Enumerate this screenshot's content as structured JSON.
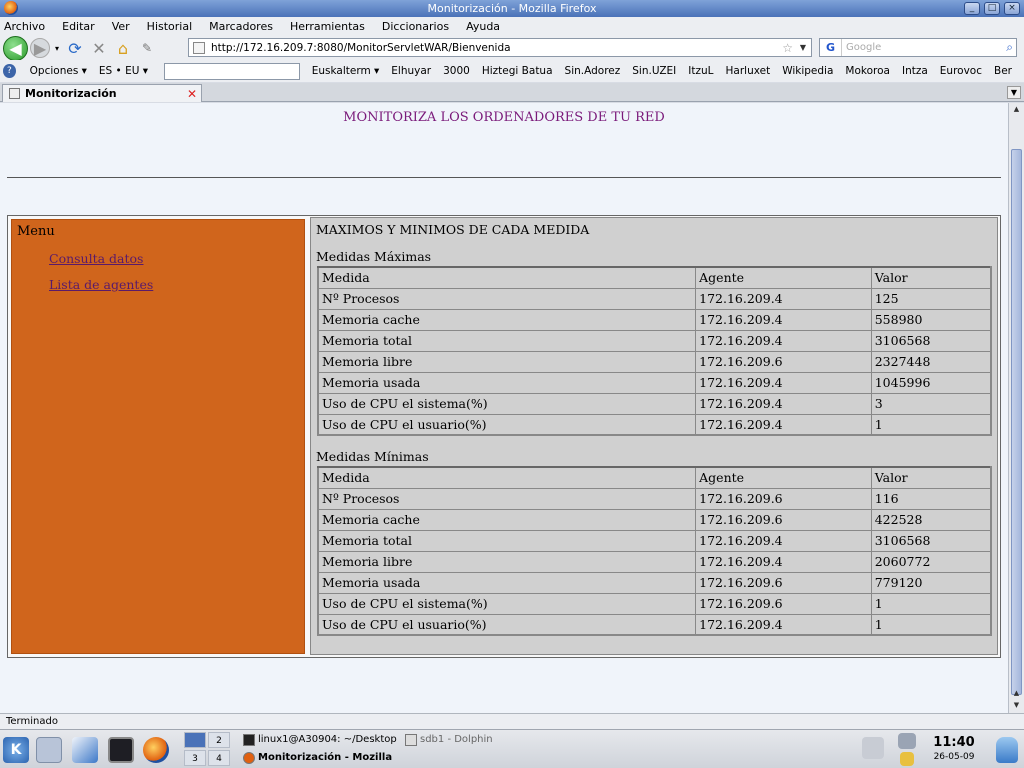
{
  "window": {
    "title": "Monitorización - Mozilla Firefox"
  },
  "menubar": {
    "items": [
      "Archivo",
      "Editar",
      "Ver",
      "Historial",
      "Marcadores",
      "Herramientas",
      "Diccionarios",
      "Ayuda"
    ]
  },
  "navbar": {
    "url": "http://172.16.209.7:8080/MonitorServletWAR/Bienvenida",
    "search_placeholder": "Google"
  },
  "bookmarks": {
    "items": [
      "Opciones ▾",
      "ES • EU ▾",
      "Euskalterm ▾",
      "Elhuyar",
      "3000",
      "Hiztegi Batua",
      "Sin.Adorez",
      "Sin.UZEI",
      "ItzuL",
      "Harluxet",
      "Wikipedia",
      "Mokoroa",
      "Intza",
      "Eurovoc",
      "Ber"
    ]
  },
  "tab": {
    "label": "Monitorización"
  },
  "page": {
    "header": "MONITORIZA LOS ORDENADORES DE TU RED",
    "menu": {
      "title": "Menu",
      "links": [
        "Consulta datos",
        "Lista de agentes"
      ]
    },
    "main_title": "MAXIMOS Y MINIMOS DE CADA MEDIDA",
    "max": {
      "title": "Medidas Máximas",
      "headers": [
        "Medida",
        "Agente",
        "Valor"
      ],
      "rows": [
        [
          "Nº Procesos",
          "172.16.209.4",
          "125"
        ],
        [
          "Memoria cache",
          "172.16.209.4",
          "558980"
        ],
        [
          "Memoria total",
          "172.16.209.4",
          "3106568"
        ],
        [
          "Memoria libre",
          "172.16.209.6",
          "2327448"
        ],
        [
          "Memoria usada",
          "172.16.209.4",
          "1045996"
        ],
        [
          "Uso de CPU el sistema(%)",
          "172.16.209.4",
          "3"
        ],
        [
          "Uso de CPU el usuario(%)",
          "172.16.209.4",
          "1"
        ]
      ]
    },
    "min": {
      "title": "Medidas Mínimas",
      "headers": [
        "Medida",
        "Agente",
        "Valor"
      ],
      "rows": [
        [
          "Nº Procesos",
          "172.16.209.6",
          "116"
        ],
        [
          "Memoria cache",
          "172.16.209.6",
          "422528"
        ],
        [
          "Memoria total",
          "172.16.209.4",
          "3106568"
        ],
        [
          "Memoria libre",
          "172.16.209.4",
          "2060772"
        ],
        [
          "Memoria usada",
          "172.16.209.6",
          "779120"
        ],
        [
          "Uso de CPU el sistema(%)",
          "172.16.209.6",
          "1"
        ],
        [
          "Uso de CPU el usuario(%)",
          "172.16.209.4",
          "1"
        ]
      ]
    }
  },
  "status": "Terminado",
  "taskbar": {
    "pager": [
      "",
      "2",
      "3",
      "4"
    ],
    "tasks": [
      "linux1@A30904: ~/Desktop",
      "sdb1 - Dolphin",
      "Monitorización - Mozilla"
    ],
    "time": "11:40",
    "date": "26-05-09"
  },
  "icons": {
    "back": "back-arrow-icon",
    "forward": "forward-arrow-icon",
    "reload": "reload-icon",
    "stop": "stop-icon",
    "home": "home-icon"
  }
}
